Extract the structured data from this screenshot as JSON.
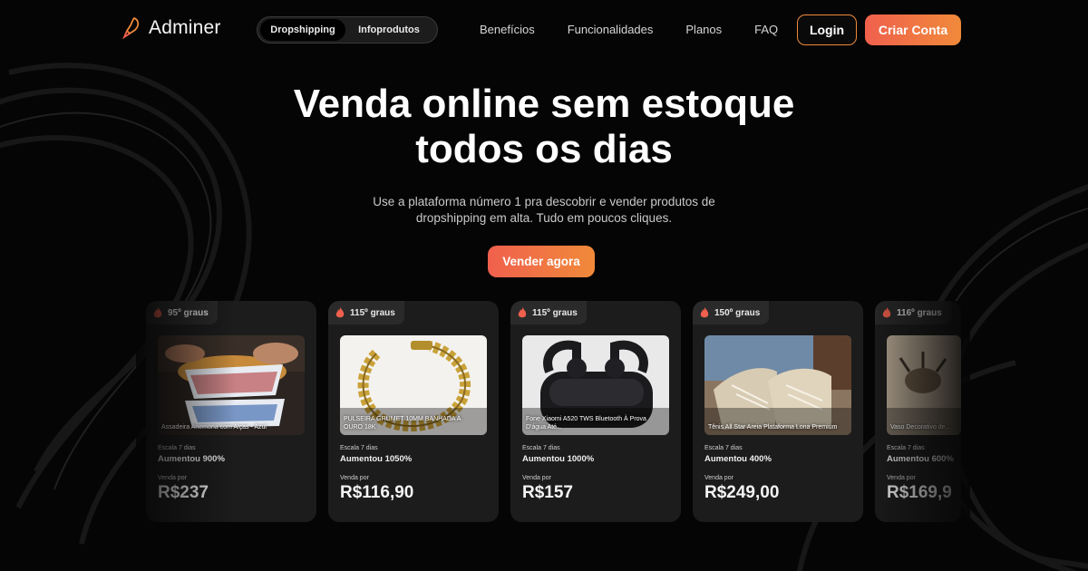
{
  "brand": {
    "name": "Adminer"
  },
  "nav": {
    "toggle": [
      "Dropshipping",
      "Infoprodutos"
    ],
    "links": [
      "Benefícios",
      "Funcionalidades",
      "Planos",
      "FAQ"
    ],
    "login": "Login",
    "signup": "Criar Conta"
  },
  "hero": {
    "title_line1": "Venda online sem estoque",
    "title_line2": "todos os dias",
    "subtitle_line1": "Use a plataforma número 1 pra descobrir e vender produtos de",
    "subtitle_line2": "dropshipping em alta. Tudo em poucos cliques.",
    "cta": "Vender agora"
  },
  "colors": {
    "accent_start": "#f0604d",
    "accent_end": "#f08a3a",
    "background": "#050505",
    "card": "#1c1c1c"
  },
  "cards": [
    {
      "badge": "95º graus",
      "name": "Assadeira Anemona com Alças - Azul",
      "scale_label": "Escala 7 dias",
      "scale_value": "Aumentou 900%",
      "sale_label": "Venda por",
      "price": "R$237",
      "icon": "flame-icon"
    },
    {
      "badge": "115º graus",
      "name": "PULSEIRA GRUMET 10MM BANHADA A OURO 18K",
      "scale_label": "Escala 7 dias",
      "scale_value": "Aumentou 1050%",
      "sale_label": "Venda por",
      "price": "R$116,90",
      "icon": "flame-icon"
    },
    {
      "badge": "115º graus",
      "name": "Fone Xiaomi A520 TWS Bluetooth À Prova D'água Até...",
      "scale_label": "Escala 7 dias",
      "scale_value": "Aumentou 1000%",
      "sale_label": "Venda por",
      "price": "R$157",
      "icon": "flame-icon"
    },
    {
      "badge": "150º graus",
      "name": "Tênis All Star Areia Plataforma Lona Premium",
      "scale_label": "Escala 7 dias",
      "scale_value": "Aumentou 400%",
      "sale_label": "Venda por",
      "price": "R$249,00",
      "icon": "flame-icon"
    },
    {
      "badge": "116º graus",
      "name": "Vaso Decorativo de...",
      "scale_label": "Escala 7 dias",
      "scale_value": "Aumentou 600%",
      "sale_label": "Venda por",
      "price": "R$169,9",
      "icon": "flame-icon"
    }
  ]
}
